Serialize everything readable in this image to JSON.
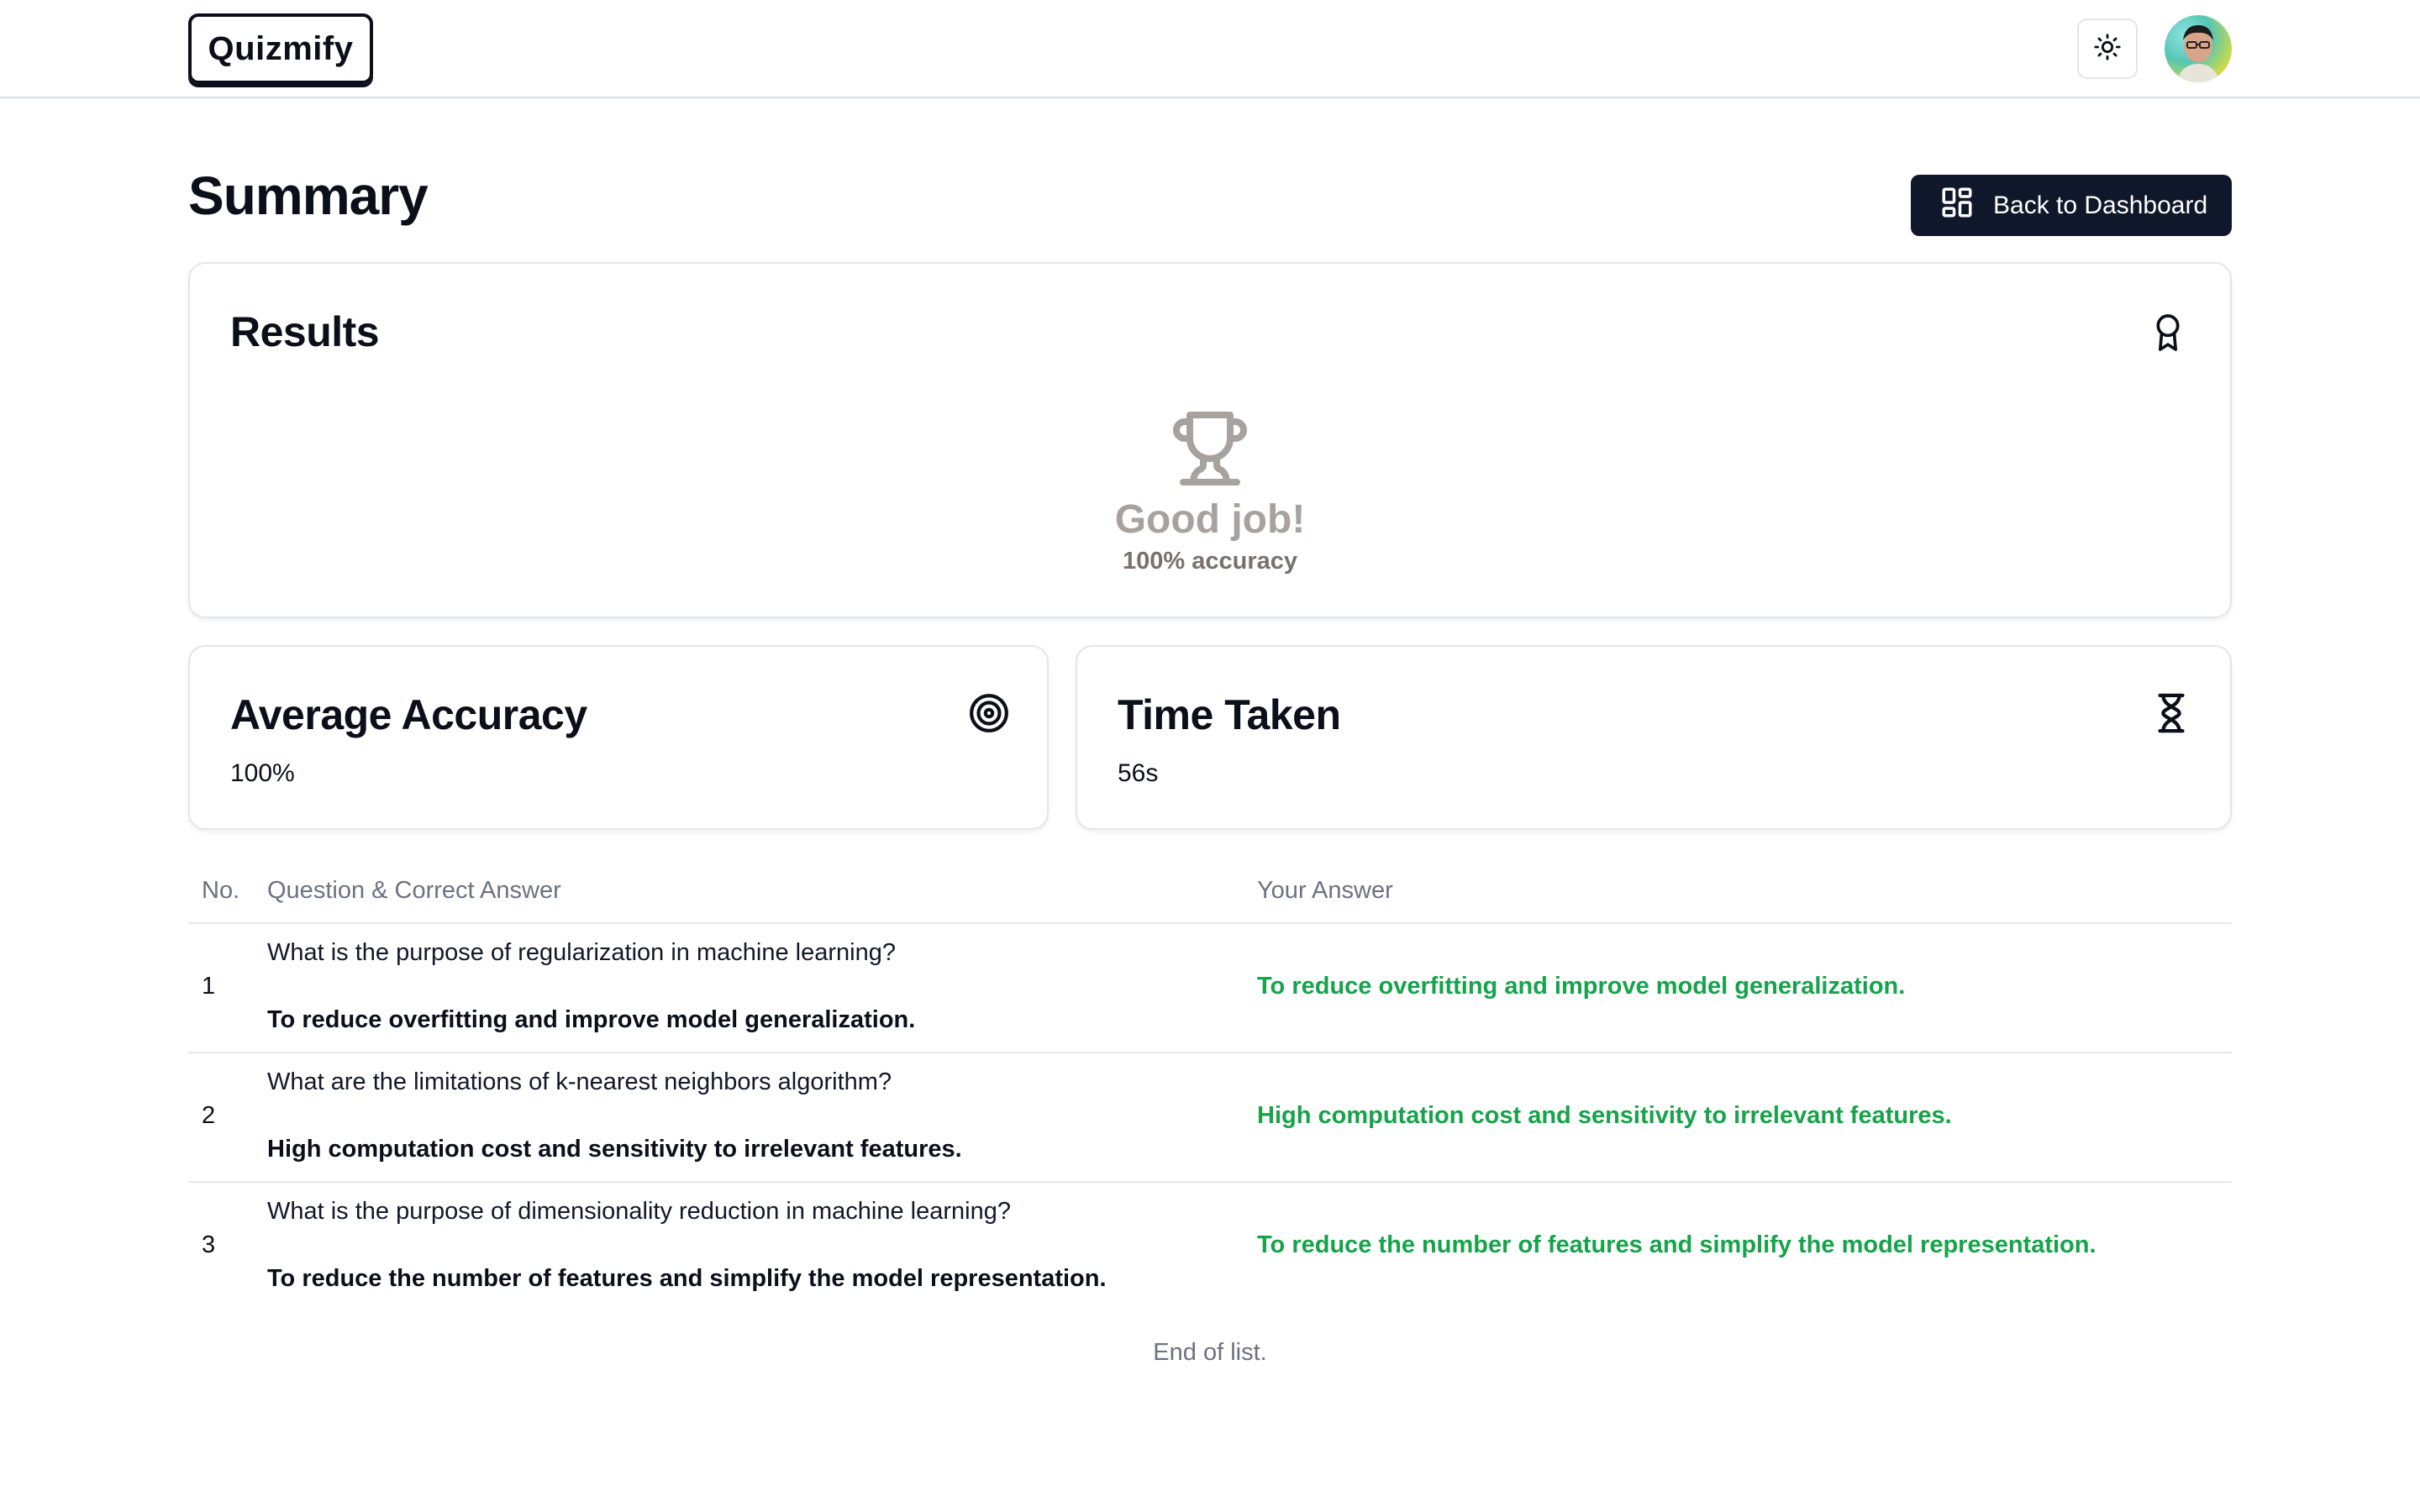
{
  "navbar": {
    "logo": "Quizmify",
    "theme_toggle_icon": "sun-icon",
    "avatar": "user-avatar"
  },
  "header": {
    "title": "Summary",
    "back_button_label": "Back to Dashboard",
    "back_button_icon": "dashboard-grid-icon"
  },
  "results": {
    "title": "Results",
    "icon": "award-icon",
    "trophy_icon": "trophy-icon",
    "message": "Good job!",
    "accuracy_text": "100% accuracy"
  },
  "average_accuracy": {
    "title": "Average Accuracy",
    "icon": "target-icon",
    "value": "100%"
  },
  "time_taken": {
    "title": "Time Taken",
    "icon": "hourglass-icon",
    "value": "56s"
  },
  "table": {
    "headers": {
      "no": "No.",
      "question": "Question & Correct Answer",
      "your_answer": "Your Answer"
    },
    "rows": [
      {
        "no": "1",
        "question": "What is the purpose of regularization in machine learning?",
        "correct_answer": "To reduce overfitting and improve model generalization.",
        "your_answer": "To reduce overfitting and improve model generalization."
      },
      {
        "no": "2",
        "question": "What are the limitations of k-nearest neighbors algorithm?",
        "correct_answer": "High computation cost and sensitivity to irrelevant features.",
        "your_answer": "High computation cost and sensitivity to irrelevant features."
      },
      {
        "no": "3",
        "question": "What is the purpose of dimensionality reduction in machine learning?",
        "correct_answer": "To reduce the number of features and simplify the model representation.",
        "your_answer": "To reduce the number of features and simplify the model representation."
      }
    ],
    "footer": "End of list."
  },
  "colors": {
    "primary": "#0f172a",
    "correct": "#16a34a",
    "muted": "#6b7280",
    "trophy": "#a8a29e"
  }
}
